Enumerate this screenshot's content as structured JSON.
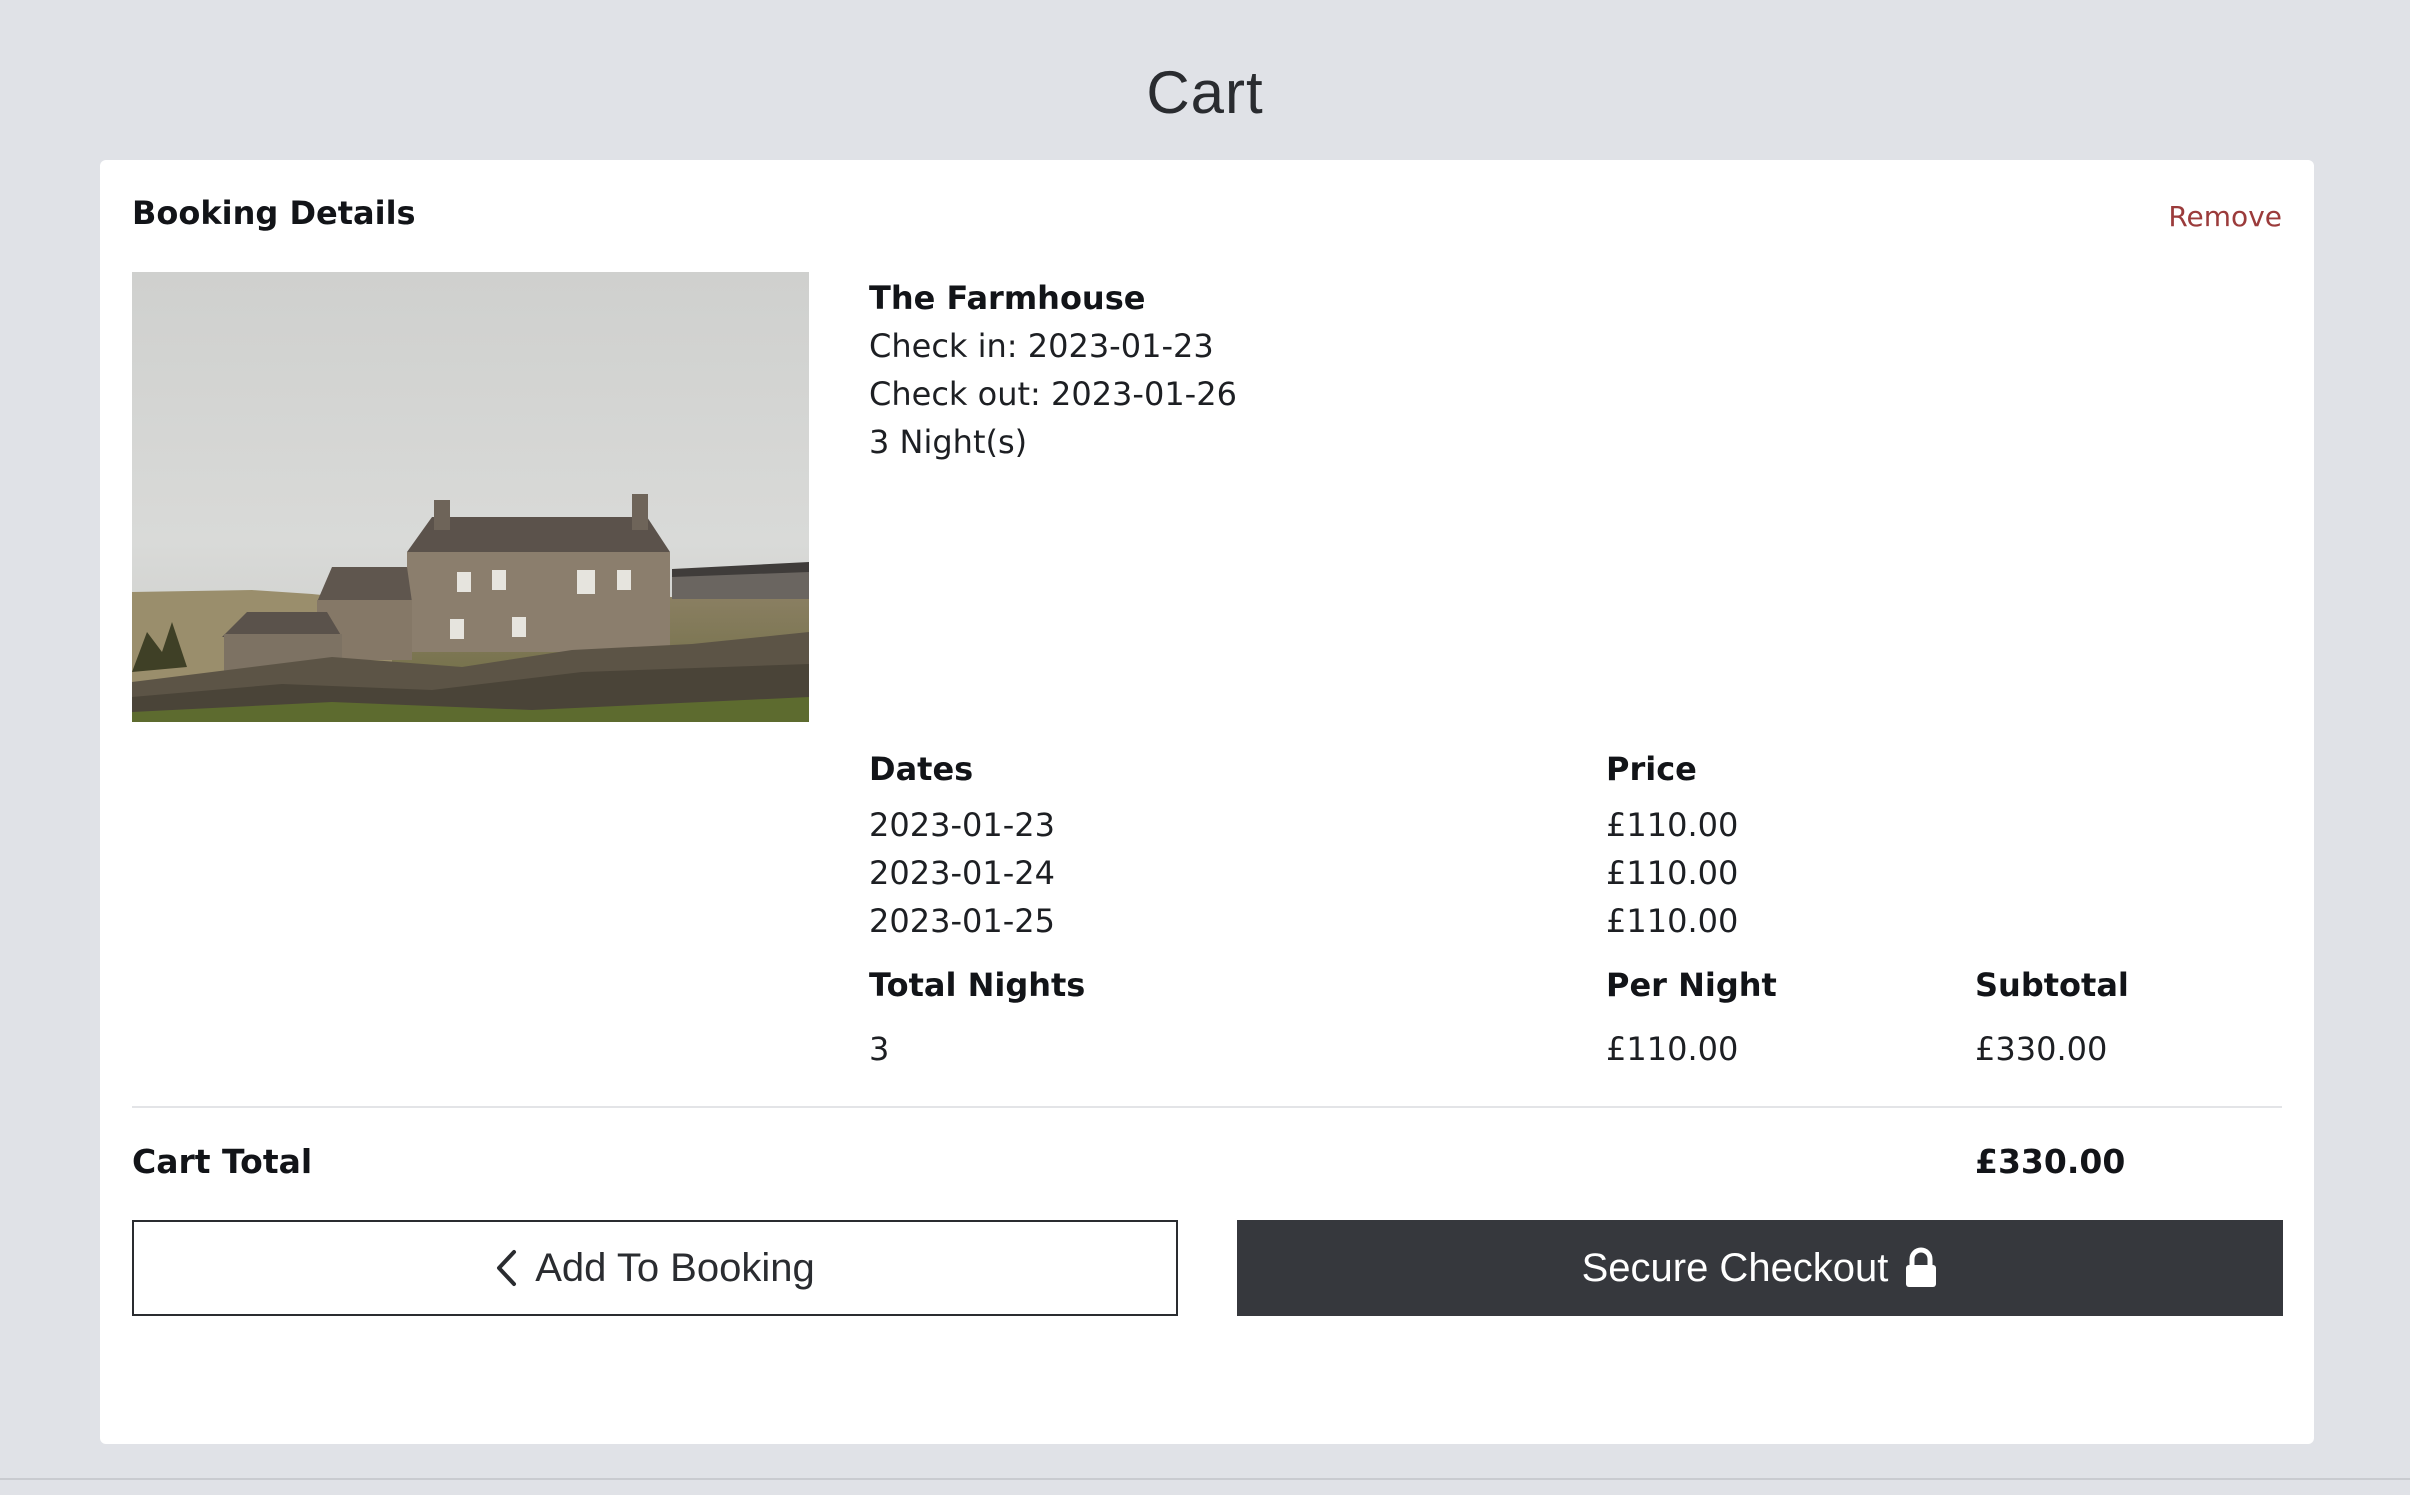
{
  "page": {
    "title": "Cart"
  },
  "booking": {
    "heading": "Booking Details",
    "remove_label": "Remove",
    "property_name": "The Farmhouse",
    "check_in": "Check in: 2023-01-23",
    "check_out": "Check out: 2023-01-26",
    "nights_text": "3 Night(s)",
    "image_alt": "farmhouse-photo"
  },
  "breakdown": {
    "headers": {
      "dates": "Dates",
      "price": "Price"
    },
    "rows": [
      {
        "date": "2023-01-23",
        "price": "£110.00"
      },
      {
        "date": "2023-01-24",
        "price": "£110.00"
      },
      {
        "date": "2023-01-25",
        "price": "£110.00"
      }
    ],
    "summary_headers": {
      "total_nights": "Total Nights",
      "per_night": "Per Night",
      "subtotal": "Subtotal"
    },
    "summary": {
      "total_nights": "3",
      "per_night": "£110.00",
      "subtotal": "£330.00"
    }
  },
  "totals": {
    "label": "Cart Total",
    "value": "£330.00"
  },
  "actions": {
    "add_label": "Add To Booking",
    "add_icon": "chevron-left-icon",
    "checkout_label": "Secure Checkout",
    "checkout_icon": "lock-icon"
  },
  "colors": {
    "background": "#e0e2e7",
    "remove": "#9b3b3b",
    "checkout_bg": "#36383d"
  }
}
